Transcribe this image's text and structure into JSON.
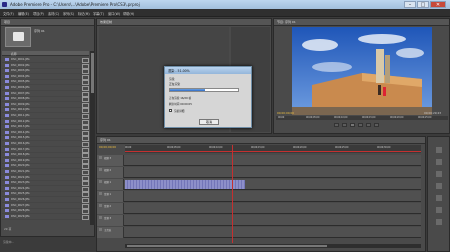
{
  "window": {
    "title": "Adobe Premiere Pro - C:\\Users\\...\\Adobe\\Premiere Pro\\CS3\\.prproj",
    "min_glyph": "–",
    "max_glyph": "□",
    "close_glyph": "✕"
  },
  "menu": [
    "文件(F)",
    "编辑(E)",
    "项目(P)",
    "素材(C)",
    "序列(S)",
    "标记(M)",
    "字幕(T)",
    "窗口(W)",
    "帮助(H)"
  ],
  "project_panel": {
    "tab": "项目",
    "bin_name": "序列 01",
    "header": "名称",
    "rows": [
      {
        "name": "DSC_0001.JPG",
        "ext": ".JPG"
      },
      {
        "name": "DSC_0002.JPG",
        "ext": ".JPG"
      },
      {
        "name": "DSC_0003.JPG",
        "ext": ".JPG"
      },
      {
        "name": "DSC_0004.JPG",
        "ext": ".JPG"
      },
      {
        "name": "DSC_0005.JPG",
        "ext": ".JPG"
      },
      {
        "name": "DSC_0006.JPG",
        "ext": ".JPG"
      },
      {
        "name": "DSC_0007.JPG",
        "ext": ".JPG"
      },
      {
        "name": "DSC_0008.JPG",
        "ext": ".JPG"
      },
      {
        "name": "DSC_0009.JPG",
        "ext": ".JPG"
      },
      {
        "name": "DSC_0010.JPG",
        "ext": ".JPG"
      },
      {
        "name": "DSC_0011.JPG",
        "ext": ".JPG"
      },
      {
        "name": "DSC_0012.JPG",
        "ext": ".JPG"
      },
      {
        "name": "DSC_0013.JPG",
        "ext": ".JPG"
      },
      {
        "name": "DSC_0014.JPG",
        "ext": ".JPG"
      },
      {
        "name": "DSC_0015.JPG",
        "ext": ".JPG"
      },
      {
        "name": "DSC_0016.JPG",
        "ext": ".JPG"
      },
      {
        "name": "DSC_0017.JPG",
        "ext": ".JPG"
      },
      {
        "name": "DSC_0018.JPG",
        "ext": ".JPG"
      },
      {
        "name": "DSC_0019.JPG",
        "ext": ".JPG"
      },
      {
        "name": "DSC_0020.JPG",
        "ext": ".JPG"
      },
      {
        "name": "DSC_0021.JPG",
        "ext": ".JPG"
      },
      {
        "name": "DSC_0022.JPG",
        "ext": ".JPG"
      },
      {
        "name": "DSC_0023.JPG",
        "ext": ".JPG"
      },
      {
        "name": "DSC_0024.JPG",
        "ext": ".JPG"
      },
      {
        "name": "DSC_0025.JPG",
        "ext": ".JPG"
      },
      {
        "name": "DSC_0026.JPG",
        "ext": ".JPG"
      },
      {
        "name": "DSC_0027.JPG",
        "ext": ".JPG"
      },
      {
        "name": "DSC_0028.JPG",
        "ext": ".JPG"
      },
      {
        "name": "DSC_0029.JPG",
        "ext": ".JPG"
      }
    ],
    "footer": "29 项"
  },
  "source_panel": {
    "tab": "效果控制"
  },
  "program_monitor": {
    "tab": "节目: 序列 01",
    "timecode_left": "00;00;00;00",
    "timecode_right": "00;00;29;23",
    "ruler_labels": [
      "00;00",
      "00;00;05;00",
      "00;00;10;00",
      "00;00;15;00",
      "00;00;20;00",
      "00;00;25;00"
    ]
  },
  "dialog": {
    "title": "渲染 - 51.00%",
    "group_label": "渲染",
    "line1": "正在渲染",
    "progress_fraction": 0.51,
    "line2": "正在渲染 16/29 帧",
    "line3": "剩余时间 00:00:05",
    "check_label": "渲染详细",
    "cancel_label": "取消"
  },
  "timeline": {
    "tab": "序列 01",
    "timecode": "00;00;00;00",
    "ruler_labels": [
      "00;00",
      "00;00;05;00",
      "00;00;10;00",
      "00;00;15;00",
      "00;00;20;00",
      "00;00;25;00",
      "00;00;30;00"
    ],
    "tracks": [
      "视频 3",
      "视频 2",
      "视频 1",
      "音频 1",
      "音频 2",
      "音频 3",
      "主音轨"
    ],
    "playhead_fraction": 0.36
  },
  "status": {
    "text": "渲染中..."
  },
  "colors": {
    "accent": "#2f6cc7",
    "clip": "#8d8fc9",
    "timecode": "#f0c040",
    "playhead": "#c43030"
  }
}
